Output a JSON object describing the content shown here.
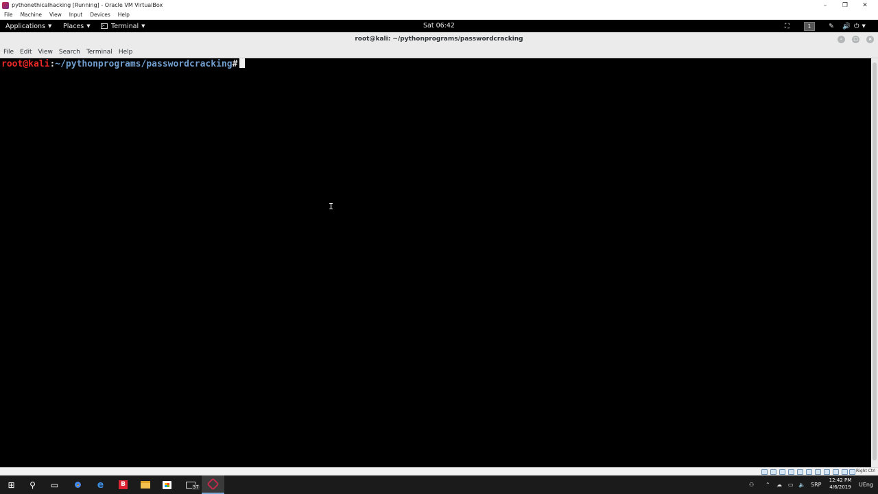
{
  "host_window": {
    "title": "pythonethicalhacking [Running] - Oracle VM VirtualBox",
    "menu": [
      "File",
      "Machine",
      "View",
      "Input",
      "Devices",
      "Help"
    ],
    "controls": [
      "minimize-icon",
      "restore-icon",
      "close-icon"
    ]
  },
  "gnome_panel": {
    "applications": "Applications",
    "places": "Places",
    "terminal": "Terminal",
    "clock": "Sat 06:42",
    "workspace": "1"
  },
  "terminal": {
    "window_title": "root@kali: ~/pythonprograms/passwordcracking",
    "menu": [
      "File",
      "Edit",
      "View",
      "Search",
      "Terminal",
      "Help"
    ],
    "prompt_user": "root@kali",
    "prompt_sep": ":",
    "prompt_path": "~/pythonprograms/passwordcracking",
    "prompt_symbol": "#"
  },
  "vbox_status": {
    "host_key": "Right Ctrl"
  },
  "taskbar": {
    "clock_time": "12:42 PM",
    "clock_date": "4/6/2019",
    "lang": "SRP",
    "mail_count": "37",
    "user_label": "UEng"
  }
}
